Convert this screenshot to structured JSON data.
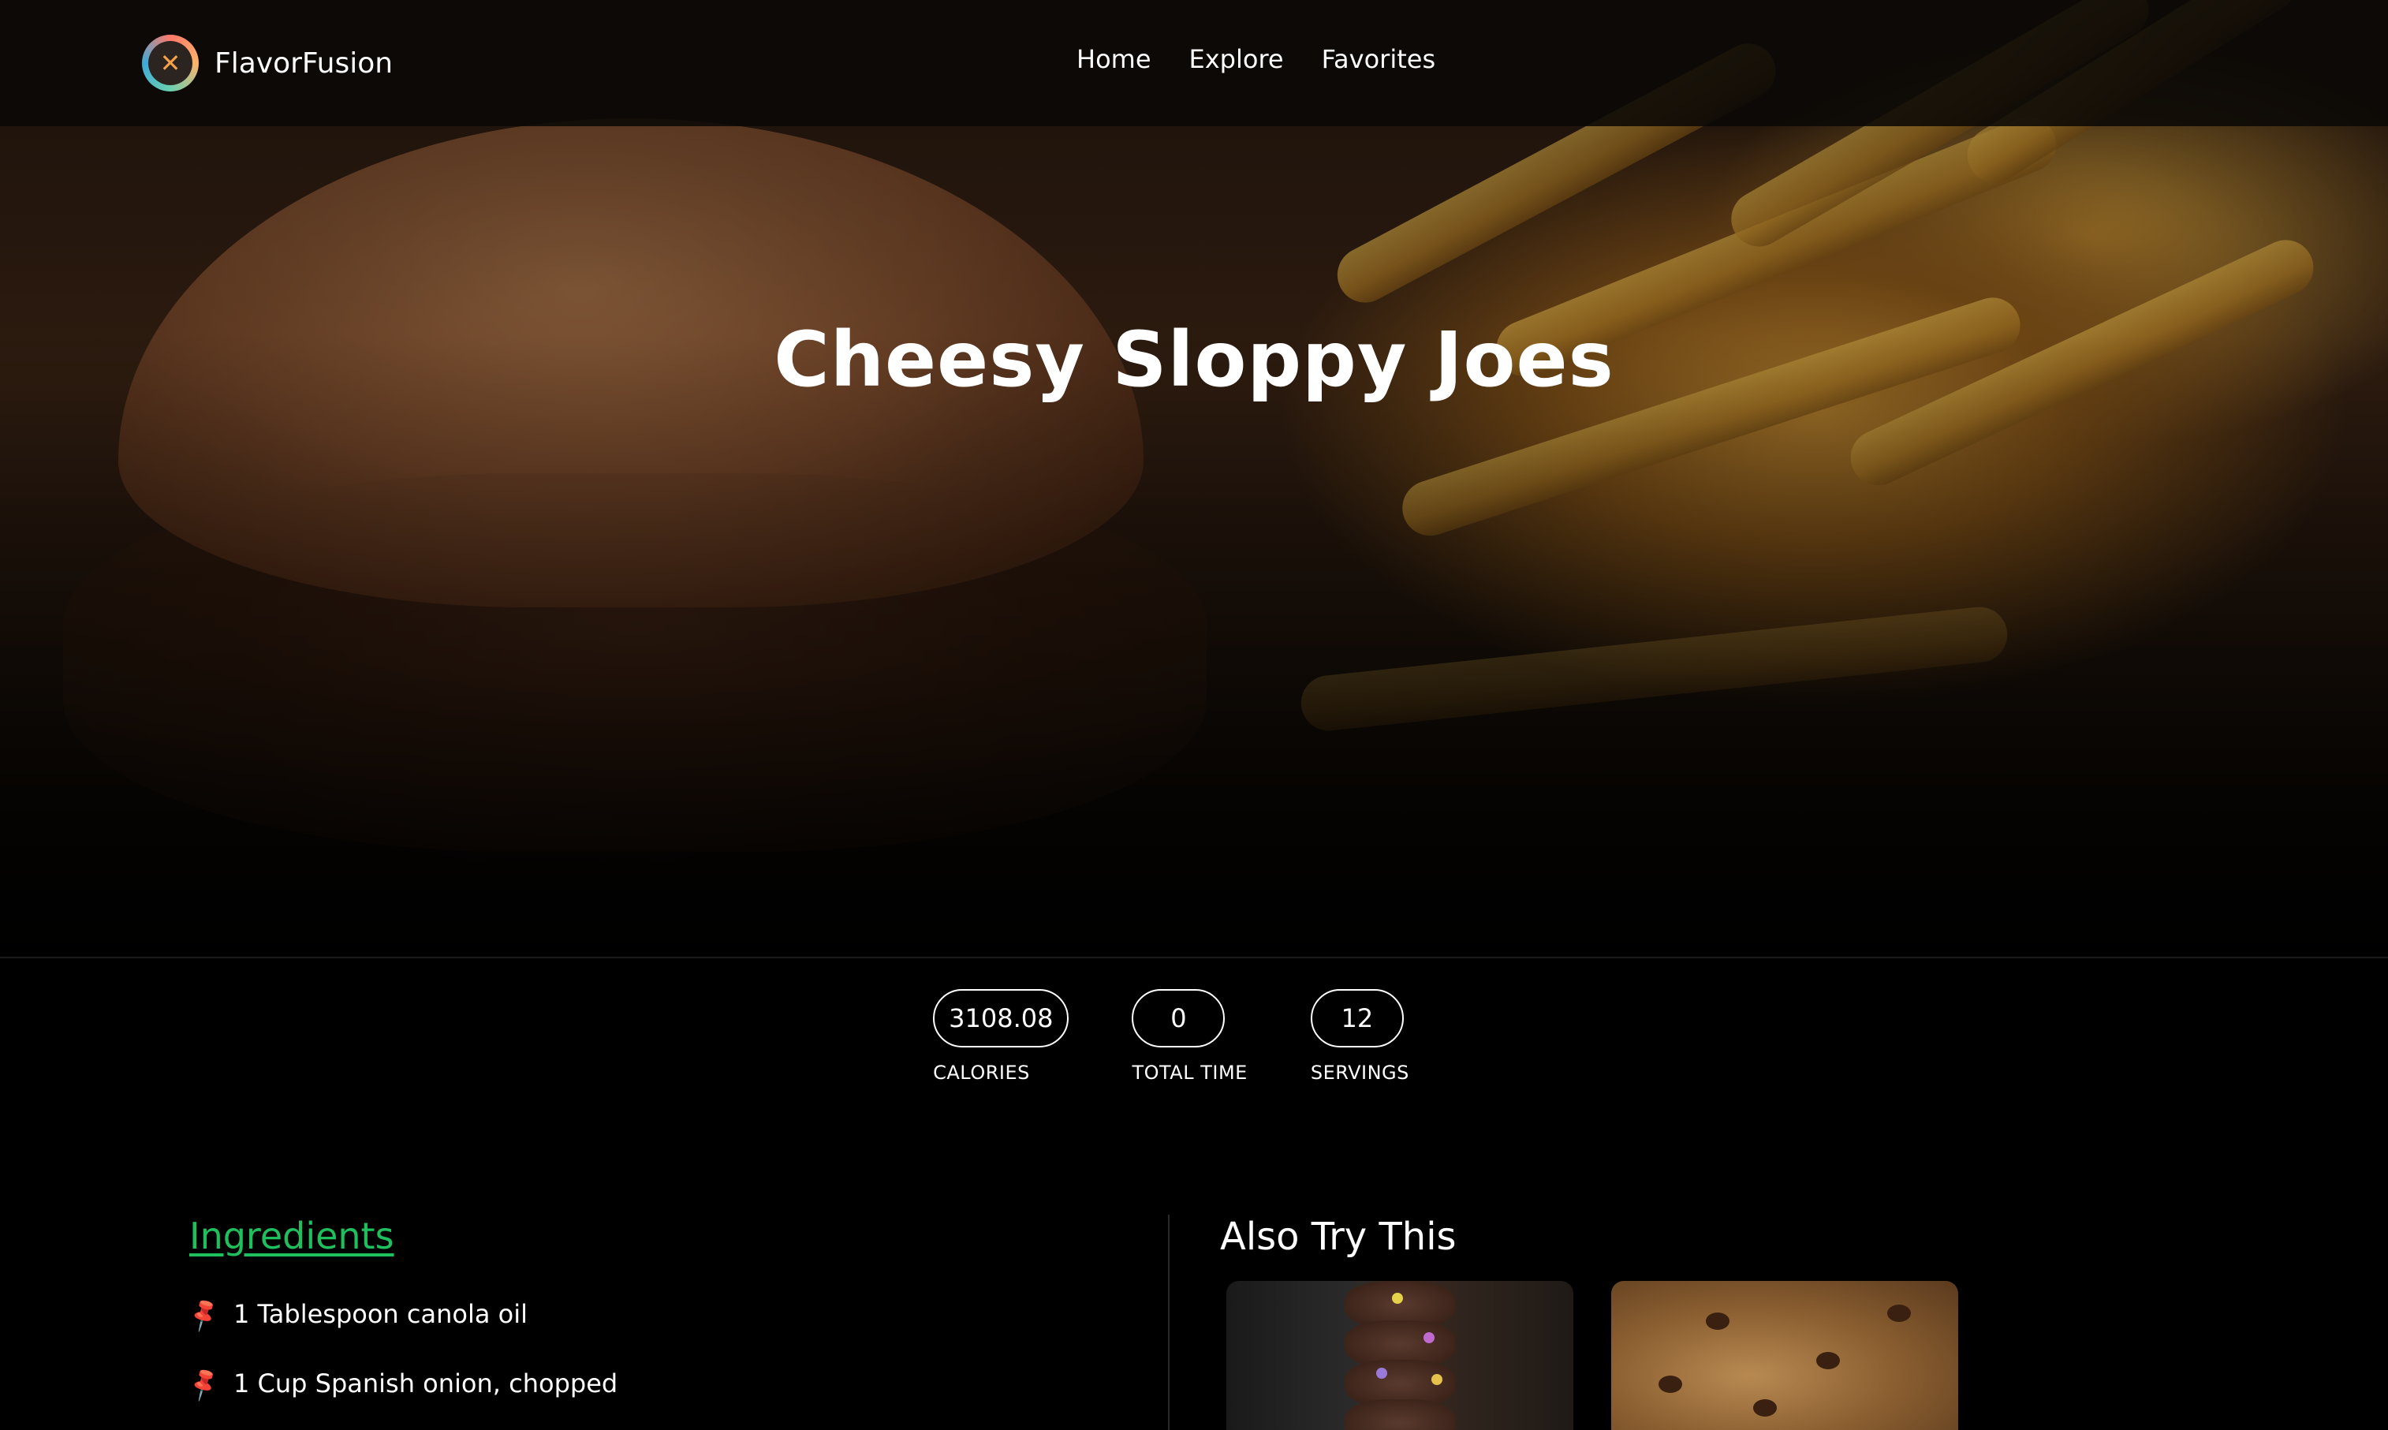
{
  "brand": {
    "name": "FlavorFusion",
    "logo_icon": "utensils-logo-icon"
  },
  "nav": {
    "links": [
      "Home",
      "Explore",
      "Favorites"
    ]
  },
  "hero": {
    "title": "Cheesy Sloppy Joes"
  },
  "stats": [
    {
      "value": "3108.08",
      "label": "CALORIES"
    },
    {
      "value": "0",
      "label": "TOTAL TIME"
    },
    {
      "value": "12",
      "label": "SERVINGS"
    }
  ],
  "ingredients": {
    "title": "Ingredients",
    "icon": "pin-icon",
    "items": [
      "1 Tablespoon canola oil",
      "1 Cup Spanish onion, chopped"
    ]
  },
  "also_try": {
    "title": "Also Try This"
  },
  "colors": {
    "accent": "#1fbf5e",
    "background": "#000000"
  }
}
